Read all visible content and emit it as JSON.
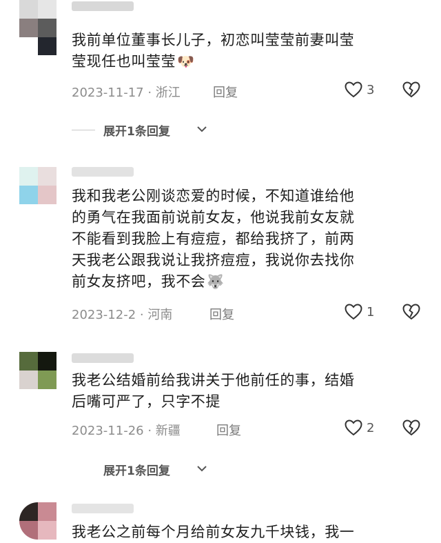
{
  "comments": [
    {
      "text_line1": "我前单位董事长儿子，初恋叫莹莹前妻叫莹",
      "text_line2": "莹现任也叫莹莹",
      "emoji": "🐶",
      "date_location": "2023-11-17 · 浙江",
      "reply_label": "回复",
      "likes": "3"
    },
    {
      "text_line1": "我和我老公刚谈恋爱的时候，不知道谁给他",
      "text_line2": "的勇气在我面前说前女友，他说我前女友就",
      "text_line3": "不能看到我脸上有痘痘，都给我挤了，前两",
      "text_line4": "天我老公跟我说让我挤痘痘，我说你去找你",
      "text_line5": "前女友挤吧，我不会",
      "emoji": "🐺",
      "date_location": "2023-12-2 · 河南",
      "reply_label": "回复",
      "likes": "1"
    },
    {
      "text_line1": "我老公结婚前给我讲关于他前任的事，结婚",
      "text_line2": "后嘴可严了，只字不提",
      "date_location": "2023-11-26 · 新疆",
      "reply_label": "回复",
      "likes": "2"
    },
    {
      "text_line1": "我老公之前每个月给前女友九千块钱，我一"
    }
  ],
  "expand_replies": [
    {
      "label": "展开1条回复"
    },
    {
      "label": "展开1条回复"
    }
  ],
  "icons": {
    "like": "heart-outline-icon",
    "dislike": "broken-heart-icon",
    "expand": "chevron-down-icon"
  }
}
